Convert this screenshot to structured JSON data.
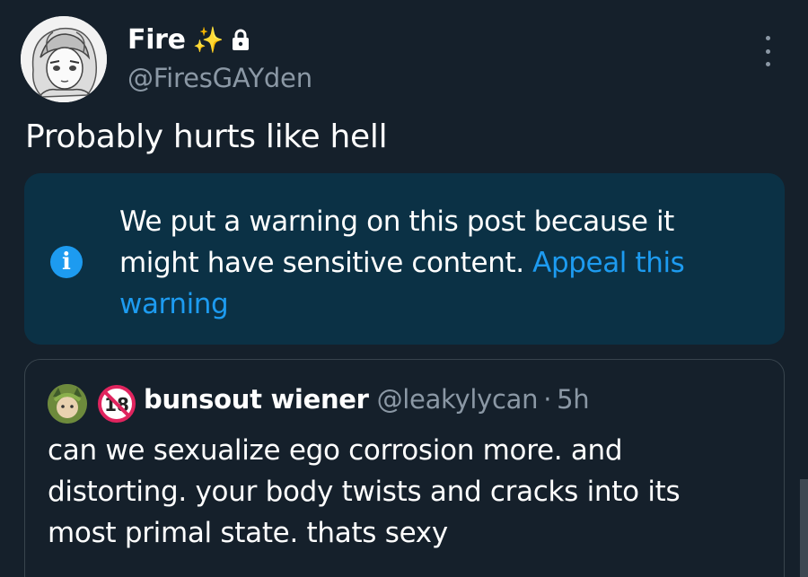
{
  "author": {
    "display_name": "Fire",
    "emoji": "✨",
    "handle": "@FiresGAYden"
  },
  "post": {
    "text": "Probably hurts like hell"
  },
  "warning": {
    "message": "We put a warning on this post because it might have sensitive content.",
    "appeal_label": "Appeal this warning"
  },
  "quoted_post": {
    "display_name": "bunsout wiener",
    "handle": "@leakylycan",
    "separator": "·",
    "time": "5h",
    "text": "can we sexualize ego corrosion more. and distorting. your body twists and cracks into its most primal state. thats sexy"
  },
  "colors": {
    "background": "#15202b",
    "accent": "#1d9bf0",
    "warning_bg": "#0b3145",
    "secondary_text": "#8b98a5"
  }
}
